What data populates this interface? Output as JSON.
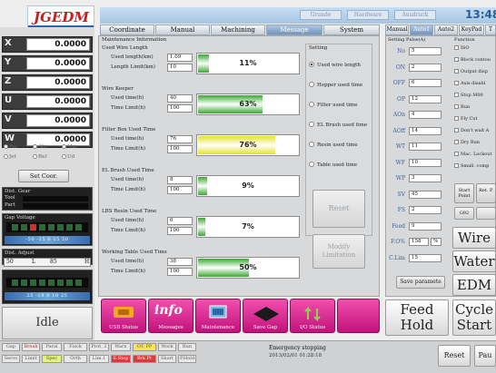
{
  "logo": {
    "text": "JGEDM"
  },
  "clock": "13:48",
  "top_buttons": [
    "Grunde",
    "Hardware",
    "Ausdruck"
  ],
  "axes": [
    {
      "label": "X",
      "value": "0.0000"
    },
    {
      "label": "Y",
      "value": "0.0000"
    },
    {
      "label": "Z",
      "value": "0.0000"
    },
    {
      "label": "U",
      "value": "0.0000"
    },
    {
      "label": "V",
      "value": "0.0000"
    },
    {
      "label": "W",
      "value": "0.0000"
    }
  ],
  "coord_radios": [
    "Rel",
    "Abs",
    "Mac",
    "Jet",
    "Ref",
    "Ud"
  ],
  "set_coor": "Set Coor.",
  "dist_labels": {
    "title": "Dist. Gear",
    "tool": "Tool",
    "part": "Part"
  },
  "gap_voltage": "Gap Voltage",
  "dist_adj": {
    "label": "Dist. Adjust",
    "value1": "50",
    "l": "L",
    "value2": "85",
    "h": "H"
  },
  "scale_text": "-50 -15 0 15 50",
  "scale_text2": "25 -18 0 18 25",
  "idle": "Idle",
  "tabs": [
    "Coordinate",
    "Manual",
    "Machining",
    "Message",
    "System"
  ],
  "right_tabs": [
    "Manual",
    "Auto1",
    "Auto2",
    "KeyPad",
    "T"
  ],
  "maint": {
    "title": "Maintenance Information",
    "groups": [
      {
        "title": "Used Wire Length",
        "row1_label": "Used length(km)",
        "row1_val": "1.09",
        "row2_label": "Length Limit(km)",
        "row2_val": "10",
        "pct": "11%",
        "fill": 0.11,
        "color": "#3aa832"
      },
      {
        "title": "Wire Keeper",
        "row1_label": "Used time(h)",
        "row1_val": "40",
        "row2_label": "Time Limit(h)",
        "row2_val": "100",
        "pct": "63%",
        "fill": 0.63,
        "color": "#3aa832"
      },
      {
        "title": "Filter Box Used Time",
        "row1_label": "Used time(h)",
        "row1_val": "76",
        "row2_label": "Time Limit(h)",
        "row2_val": "100",
        "pct": "76%",
        "fill": 0.76,
        "color": "#e3e22a"
      },
      {
        "title": "EL Brush Used Time",
        "row1_label": "Used time(h)",
        "row1_val": "8",
        "row2_label": "Time Limit(h)",
        "row2_val": "100",
        "pct": "9%",
        "fill": 0.09,
        "color": "#3aa832"
      },
      {
        "title": "LBS Resin Used Time",
        "row1_label": "Used time(h)",
        "row1_val": "6",
        "row2_label": "Time Limit(h)",
        "row2_val": "100",
        "pct": "7%",
        "fill": 0.07,
        "color": "#3aa832"
      },
      {
        "title": "Working Table Used Time",
        "row1_label": "Used time(h)",
        "row1_val": "38",
        "row2_label": "Time Limit(h)",
        "row2_val": "100",
        "pct": "50%",
        "fill": 0.5,
        "color": "#3aa832"
      }
    ]
  },
  "setting": {
    "title": "Setting",
    "options": [
      "Used wire length",
      "Hopper used time",
      "Filter used time",
      "EL Brush used time",
      "Resin used time",
      "Table used time"
    ],
    "selected": 0,
    "reset": "Reset",
    "modify": "Modify Limitation"
  },
  "bottom_buttons": [
    {
      "label": "USB Status",
      "name": "usb-status-button"
    },
    {
      "label": "Messages",
      "name": "messages-button",
      "logo": "info"
    },
    {
      "label": "Maintenance",
      "name": "maintenance-button"
    },
    {
      "label": "Save Gap",
      "name": "save-gap-button"
    },
    {
      "label": "I/O Status",
      "name": "io-status-button"
    },
    {
      "label": "",
      "name": "blank-pink-button"
    }
  ],
  "gen_params": {
    "title": "Setting Pulse(A)",
    "rows": [
      {
        "label": "No",
        "value": "5"
      },
      {
        "label": "ON",
        "value": "2"
      },
      {
        "label": "OFF",
        "value": "6"
      },
      {
        "label": "OP",
        "value": "12"
      },
      {
        "label": "AOn",
        "value": "4"
      },
      {
        "label": "AOff",
        "value": "14"
      },
      {
        "label": "WT",
        "value": "11"
      },
      {
        "label": "WF",
        "value": "10"
      },
      {
        "label": "WP",
        "value": "3"
      },
      {
        "label": "SV",
        "value": "45"
      },
      {
        "label": "FS",
        "value": "2"
      },
      {
        "label": "Feed",
        "value": "9"
      },
      {
        "label": "F.O%",
        "value": "158",
        "suffix": "%"
      },
      {
        "label": "C.Lim",
        "value": "15"
      }
    ],
    "save": "Save paramete"
  },
  "function": {
    "title": "Function",
    "items": [
      "ISO",
      "Block contou",
      "Output disp",
      "Axis disabl",
      "Stop M00",
      "Run",
      "Fly Cut",
      "Don't wait A",
      "Dry Run",
      "Mac. Lockout",
      "Small. comp"
    ]
  },
  "start_btns": [
    "Start Point",
    "Ret. P."
  ],
  "g92": "G92",
  "big_right": [
    "Wire",
    "Water",
    "EDM"
  ],
  "feed_hold": "Feed Hold",
  "cycle_start": "Cycle Start",
  "status": {
    "row1": [
      "Gap",
      "Break",
      "Paral",
      "Fixck",
      "Prot. 2",
      "Warn",
      "OT. PP",
      "Work",
      "Run"
    ],
    "row2": [
      "Servo",
      "Limit",
      "Spec",
      "Orth",
      "Lim.1",
      "E.Stop",
      "Brk Pt",
      "Short",
      "P.Hold"
    ],
    "message": "Emergency stopping",
    "date": "2013/02/01 01:28:18",
    "reset": "Reset",
    "pause": "Pau"
  }
}
